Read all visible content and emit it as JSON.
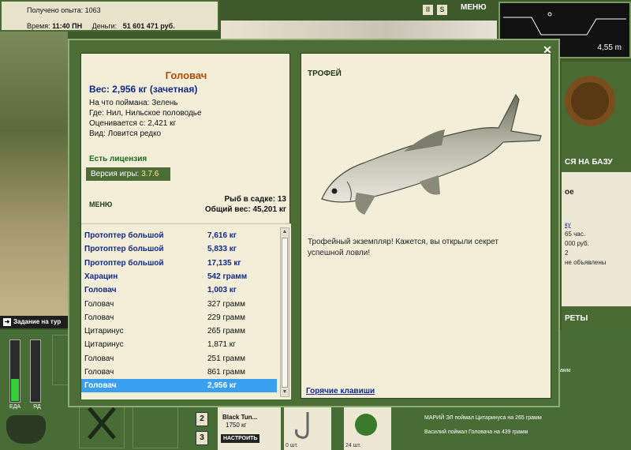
{
  "status": {
    "exp_label": "Получено опыта:",
    "exp_value": "1063",
    "time_label": "Время:",
    "time_value": "11:40 ПН",
    "money_label": "Деньги:",
    "money_value": "51 601 471 руб."
  },
  "hud": {
    "menu_label": "МЕНЮ",
    "depth": "4,55 m",
    "quest": "Задание на тур",
    "right_header1": "СЯ НА БАЗУ",
    "right_header2": "РЕТЫ",
    "right_lines": [
      "ое",
      "ку",
      "65 час.",
      "000 руб.",
      "2",
      "не объявлены"
    ],
    "right_line2": "ам",
    "food_label": "ЕДА",
    "poison_label": "ЯД"
  },
  "bottom": {
    "slot2": "2",
    "slot3": "3",
    "tackle_name": "Black Tun...",
    "tackle_weight": "1750 кг",
    "tackle_btn": "НАСТРОИТЬ",
    "hook_count": "0 шт.",
    "bait_count": "24 шт.",
    "chat": [
      "амм",
      "МАРИЙ ЭЛ поймал Цитаринуса на 265 грамм",
      "Василий поймал Головача на 439 грамм"
    ]
  },
  "dialog": {
    "fish_name": "Головач",
    "weight_line": "Вес: 2,956 кг (зачетная)",
    "caught_on": "На что поймана: Зелень",
    "where": "Где: Нил, Нильское половодье",
    "valued_from": "Оценивается с: 2,421 кг",
    "kind": "Вид: Ловится редко",
    "license": "Есть лицензия",
    "version_label": "Версия игры:",
    "version_value": "3.7.6",
    "menu_label": "МЕНЮ",
    "keep_count": "Рыб в садке: 13",
    "keep_weight": "Общий вес: 45,201 кг",
    "trophy_label": "ТРОФЕЙ",
    "trophy_msg": "Трофейный экземпляр! Кажется, вы открыли секрет успешной ловли!",
    "hotkeys": "Горячие клавиши",
    "catch_list": [
      {
        "name": "Протоптер большой",
        "weight": "7,616 кг",
        "style": "hi"
      },
      {
        "name": "Протоптер большой",
        "weight": "5,833 кг",
        "style": "hi"
      },
      {
        "name": "Протоптер большой",
        "weight": "17,135 кг",
        "style": "hi"
      },
      {
        "name": "Харацин",
        "weight": "542 грамм",
        "style": "hi"
      },
      {
        "name": "Головач",
        "weight": "1,003 кг",
        "style": "hi"
      },
      {
        "name": "Головач",
        "weight": "327 грамм",
        "style": ""
      },
      {
        "name": "Головач",
        "weight": "229 грамм",
        "style": ""
      },
      {
        "name": "Цитаринус",
        "weight": "265 грамм",
        "style": ""
      },
      {
        "name": "Цитаринус",
        "weight": "1,871 кг",
        "style": ""
      },
      {
        "name": "Головач",
        "weight": "251 грамм",
        "style": ""
      },
      {
        "name": "Головач",
        "weight": "861 грамм",
        "style": ""
      },
      {
        "name": "Головач",
        "weight": "2,956 кг",
        "style": "sel"
      }
    ]
  },
  "colors": {
    "title": "#b24a08",
    "highlight_blue": "#14288a",
    "selected_row": "#39a0f0",
    "panel_green": "#4c6e36"
  }
}
